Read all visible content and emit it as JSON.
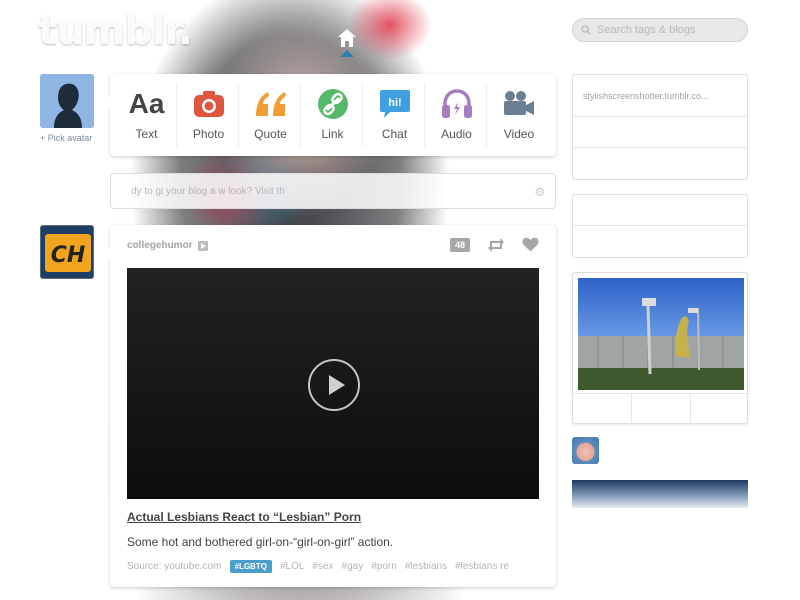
{
  "header": {
    "logo": "tumblr.",
    "search_placeholder": "Search tags & blogs"
  },
  "composer": {
    "pick_avatar_label": "+ Pick avatar",
    "post_types": [
      {
        "label": "Text",
        "icon": "text-icon",
        "color": "#444444"
      },
      {
        "label": "Photo",
        "icon": "camera-icon",
        "color": "#e0553e"
      },
      {
        "label": "Quote",
        "icon": "quote-icon",
        "color": "#f09d36"
      },
      {
        "label": "Link",
        "icon": "link-icon",
        "color": "#56b86b"
      },
      {
        "label": "Chat",
        "icon": "chat-icon",
        "color": "#3f9fe0"
      },
      {
        "label": "Audio",
        "icon": "headphones-icon",
        "color": "#a77dc2"
      },
      {
        "label": "Video",
        "icon": "video-camera-icon",
        "color": "#6b7f92"
      }
    ]
  },
  "notice": {
    "text": "dy to gi  your blog a  w look? Visit th"
  },
  "post": {
    "author": "collegehumor",
    "note_count": "48",
    "title": "Actual Lesbians React to “Lesbian” Porn",
    "description": "Some hot and bothered girl-on-“girl-on-girl” action.",
    "source": "Source: youtube.com",
    "tag_highlight": "#LGBTQ",
    "tags": [
      "#LOL",
      "#sex",
      "#gay",
      "#porn",
      "#lesbians",
      "#lesbians re"
    ]
  },
  "sidebar": {
    "box1_rows": [
      "stylishscreenshotter.tumblr.co...",
      "",
      ""
    ],
    "box2_rows": [
      "",
      ""
    ]
  },
  "colors": {
    "accent": "#4a9ec9",
    "home_caret": "#2f80a8"
  }
}
